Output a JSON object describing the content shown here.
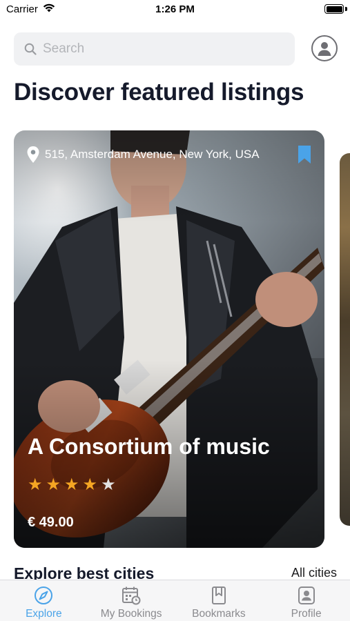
{
  "status_bar": {
    "carrier": "Carrier",
    "time": "1:26 PM"
  },
  "search": {
    "placeholder": "Search",
    "value": ""
  },
  "page": {
    "title": "Discover featured listings"
  },
  "featured_listing": {
    "location": "515, Amsterdam Avenue, New York, USA",
    "title": "A Consortium of music",
    "rating": 4,
    "rating_max": 5,
    "price": "€ 49.00",
    "bookmarked": true
  },
  "cities_section": {
    "title": "Explore best cities",
    "link_label": "All cities"
  },
  "tabs": [
    {
      "label": "Explore",
      "icon": "compass-icon",
      "active": true
    },
    {
      "label": "My Bookings",
      "icon": "calendar-icon",
      "active": false
    },
    {
      "label": "Bookmarks",
      "icon": "bookmark-icon",
      "active": false
    },
    {
      "label": "Profile",
      "icon": "profile-icon",
      "active": false
    }
  ],
  "colors": {
    "accent": "#4aa3e8",
    "star": "#f5a623",
    "title": "#151a2b",
    "tab_inactive": "#8a8a8e"
  }
}
